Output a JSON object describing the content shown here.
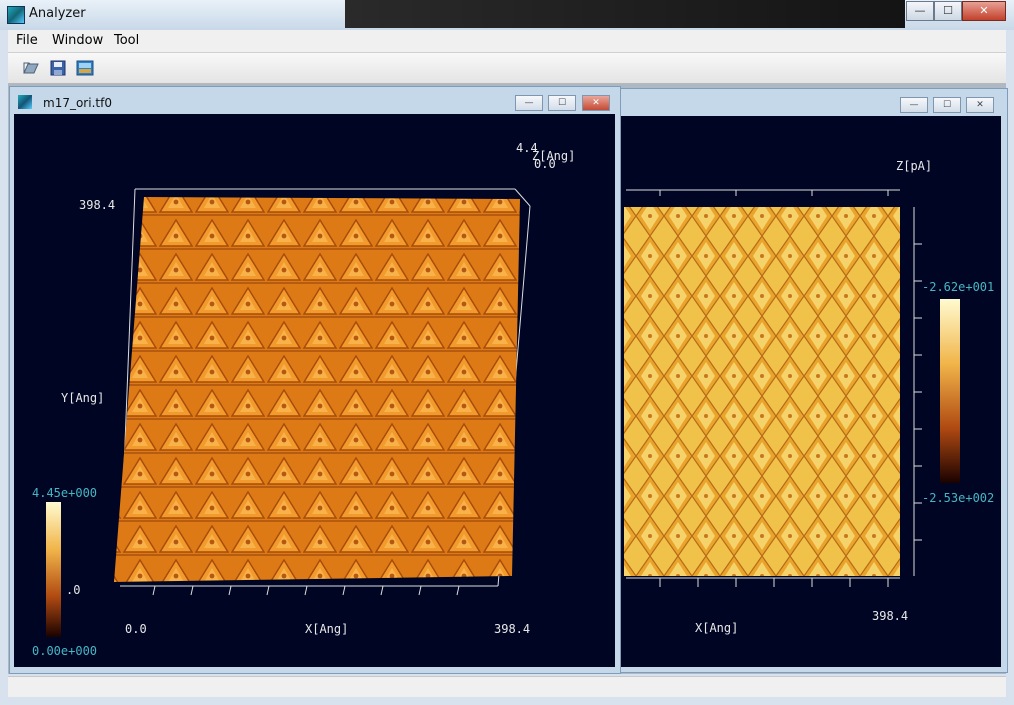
{
  "app": {
    "title": "Analyzer",
    "min": "—",
    "max": "☐",
    "close": "✕"
  },
  "menu": {
    "file": "File",
    "window": "Window",
    "tool": "Tool"
  },
  "toolbar": {
    "open": "open-icon",
    "save": "save-icon",
    "image": "image-icon"
  },
  "left_window": {
    "title": "m17_ori.tf0",
    "min": "—",
    "max": "☐",
    "close": "✕",
    "z_max": "4.4",
    "z_axis_label": "Z[Ang]",
    "z_min": "0.0",
    "y_value": "398.4",
    "y_axis_label": "Y[Ang]",
    "colorbar_top": "4.45e+000",
    "colorbar_mid": ".0",
    "colorbar_bottom": "0.00e+000",
    "x_start": "0.0",
    "x_axis_label": "X[Ang]",
    "x_end": "398.4",
    "surface_color": "#e07a14"
  },
  "right_window": {
    "min": "—",
    "max": "☐",
    "close": "✕",
    "z_axis_label": "Z[pA]",
    "colorbar_top": "-2.62e+001",
    "colorbar_bottom": "-2.53e+002",
    "x_axis_label": "X[Ang]",
    "x_end": "398.4"
  }
}
